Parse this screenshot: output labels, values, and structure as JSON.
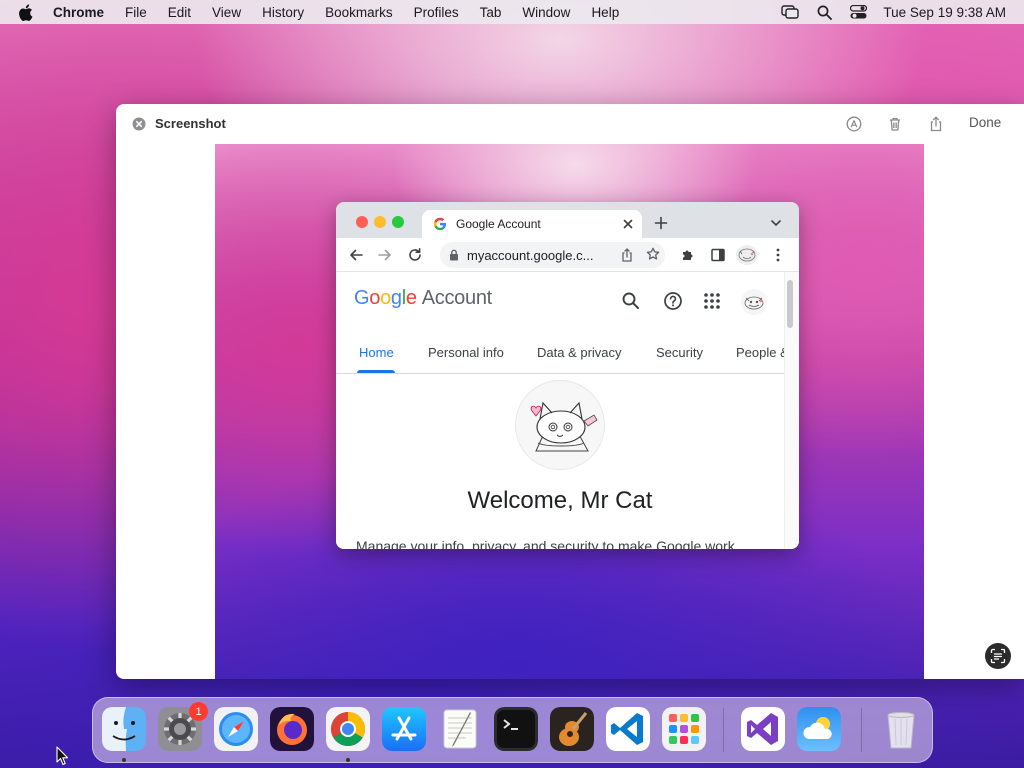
{
  "menubar": {
    "app_name": "Chrome",
    "menus": [
      "File",
      "Edit",
      "View",
      "History",
      "Bookmarks",
      "Profiles",
      "Tab",
      "Window",
      "Help"
    ],
    "clock": "Tue Sep 19  9:38 AM"
  },
  "preview": {
    "title": "Screenshot",
    "done_label": "Done"
  },
  "chrome": {
    "tab_title": "Google Account",
    "url": "myaccount.google.c..."
  },
  "account_page": {
    "logo_letters": [
      "G",
      "o",
      "o",
      "g",
      "l",
      "e"
    ],
    "logo_colors": [
      "#4285F4",
      "#EA4335",
      "#FBBC05",
      "#4285F4",
      "#34A853",
      "#EA4335"
    ],
    "logo_suffix": "Account",
    "nav_tabs": [
      "Home",
      "Personal info",
      "Data & privacy",
      "Security",
      "People &"
    ],
    "welcome": "Welcome, Mr Cat",
    "manage_text": "Manage your info, privacy, and security to make Google work"
  },
  "dock": {
    "settings_badge": "1",
    "apps": [
      "finder",
      "system-settings",
      "safari",
      "firefox",
      "chrome",
      "app-store",
      "textedit",
      "terminal",
      "garageband",
      "vscode",
      "launchpad",
      "visual-studio",
      "weather",
      "trash"
    ]
  },
  "colors": {
    "accent_blue": "#1a73e8",
    "badge_red": "#ff3b30"
  }
}
